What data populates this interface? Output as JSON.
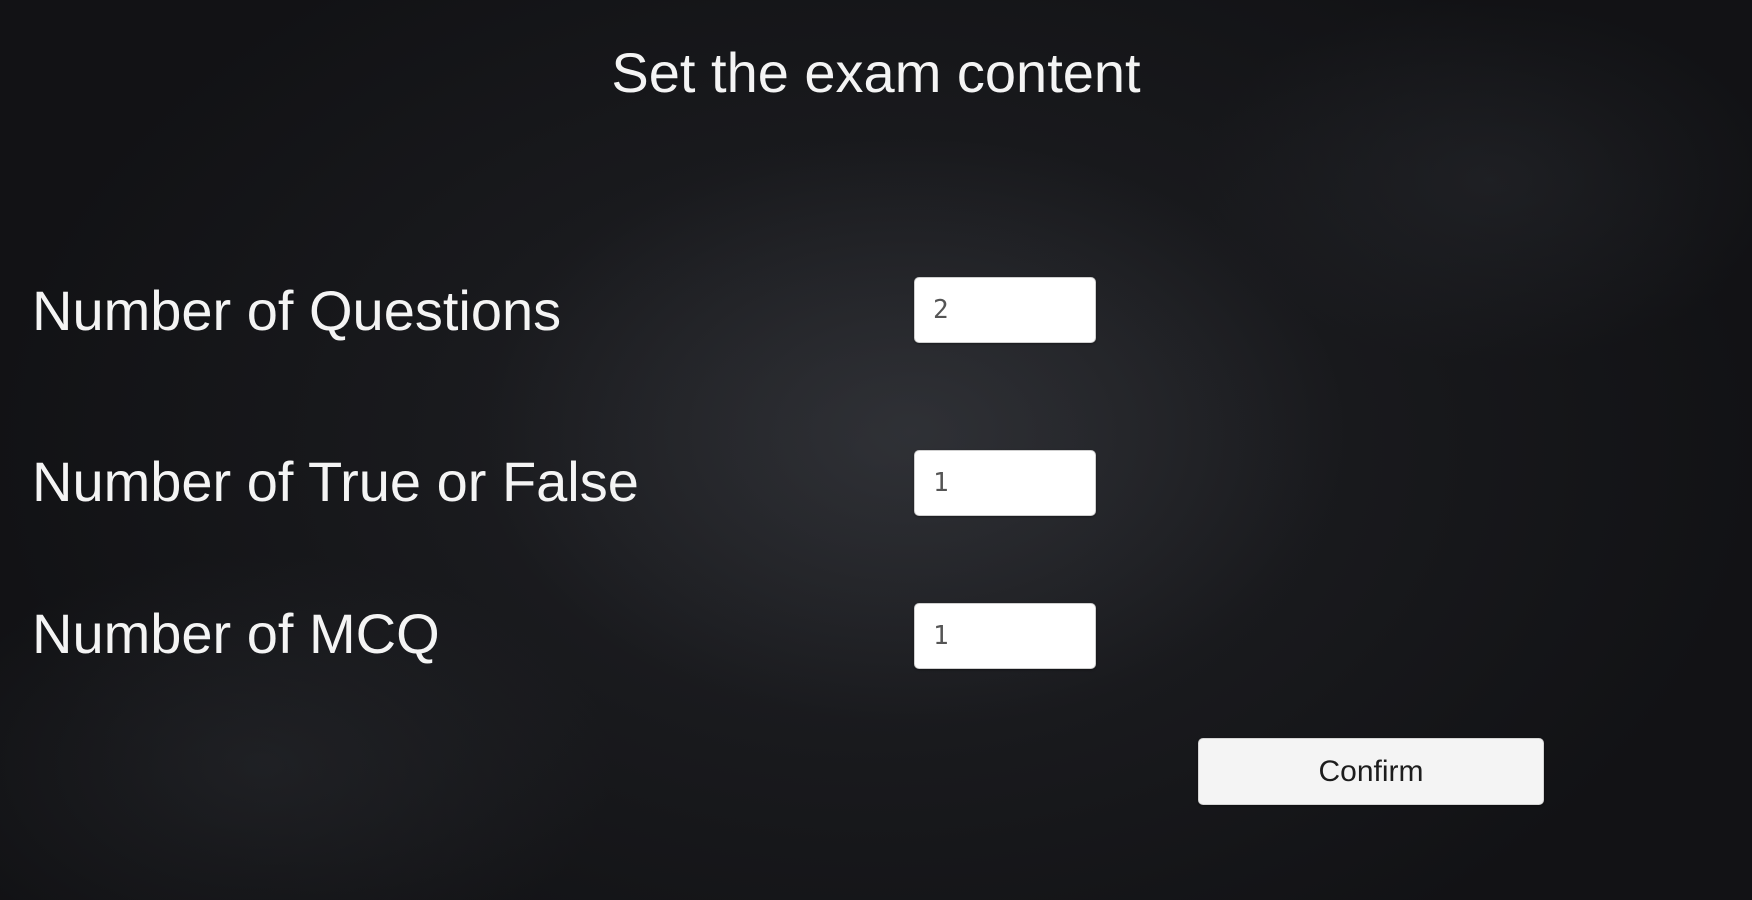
{
  "page": {
    "title": "Set the exam content",
    "background_color": "#202125",
    "text_color": "#f4f4f4"
  },
  "fields": {
    "questions": {
      "label": "Number of Questions",
      "value": "2"
    },
    "true_false": {
      "label": "Number of True or False",
      "value": "1"
    },
    "mcq": {
      "label": "Number of MCQ",
      "value": "1"
    }
  },
  "confirm_button": {
    "label": "Confirm"
  }
}
